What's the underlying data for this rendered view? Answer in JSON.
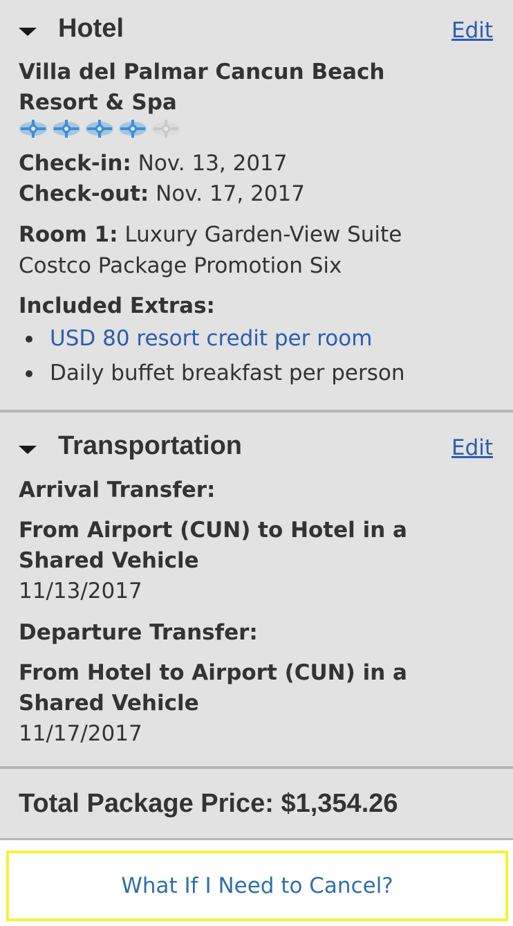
{
  "hotel": {
    "section_title": "Hotel",
    "edit_label": "Edit",
    "name_line1": "Villa del Palmar Cancun Beach",
    "name_line2": "Resort & Spa",
    "rating": 4,
    "rating_max": 5,
    "checkin_label": "Check-in:",
    "checkin_value": "Nov. 13, 2017",
    "checkout_label": "Check-out:",
    "checkout_value": "Nov. 17, 2017",
    "room_label": "Room 1:",
    "room_value": "Luxury Garden-View Suite",
    "promotion": "Costco Package Promotion Six",
    "extras_label": "Included Extras:",
    "extras": [
      {
        "text": "USD 80 resort credit per room",
        "is_link": true
      },
      {
        "text": "Daily buffet breakfast per person",
        "is_link": false
      }
    ]
  },
  "transportation": {
    "section_title": "Transportation",
    "edit_label": "Edit",
    "arrival_label": "Arrival Transfer:",
    "arrival_line1": "From Airport (CUN) to Hotel in a",
    "arrival_line2": "Shared Vehicle",
    "arrival_date": "11/13/2017",
    "departure_label": "Departure Transfer:",
    "departure_line1": "From Hotel to Airport (CUN) in a",
    "departure_line2": "Shared Vehicle",
    "departure_date": "11/17/2017"
  },
  "total": {
    "label": "Total Package Price:",
    "value": "$1,354.26"
  },
  "cancel": {
    "label": "What If I Need to Cancel?"
  },
  "colors": {
    "panel_bg": "#e2e2e2",
    "link": "#2a5db0",
    "text": "#333333",
    "highlight_border": "#f4f239",
    "star_on": "#3d8fd6",
    "star_off": "#c9c9c9"
  },
  "icons": {
    "collapse": "caret-down-icon",
    "rating": "star-icon"
  }
}
